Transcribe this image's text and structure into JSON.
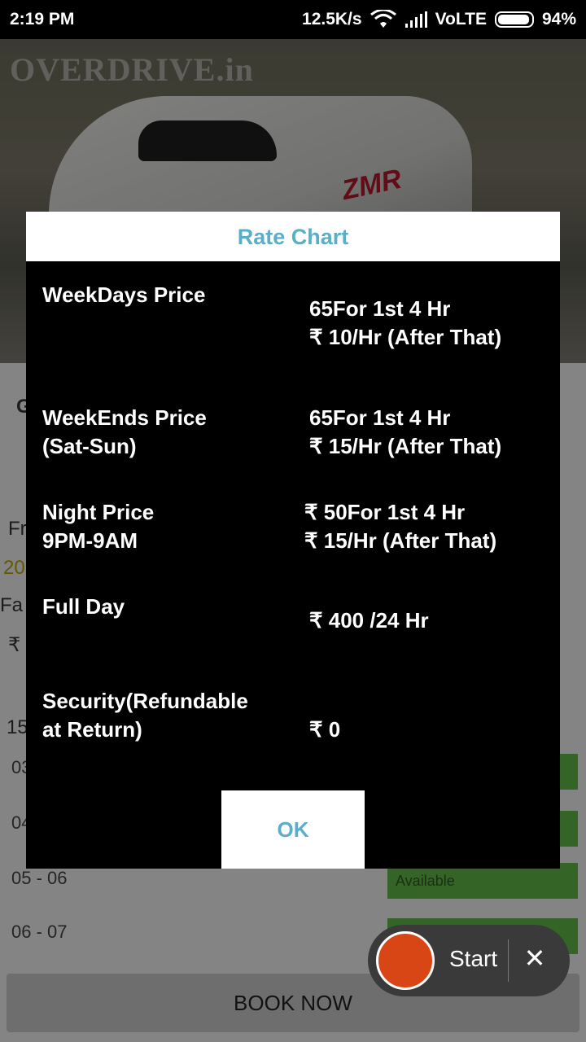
{
  "status_bar": {
    "time": "2:19 PM",
    "net_speed": "12.5K/s",
    "network": "VoLTE",
    "battery": "94%"
  },
  "hero": {
    "watermark": "OVERDRIVE.in",
    "bike_text": "ZMR"
  },
  "background": {
    "fragments": [
      "G",
      "Fr",
      "20",
      "Fa",
      "₹",
      "15"
    ],
    "slots": [
      {
        "time": "03",
        "status": ""
      },
      {
        "time": "04",
        "status": ""
      },
      {
        "time": "05 - 06",
        "status": "Available"
      },
      {
        "time": "06 - 07",
        "status": ""
      }
    ],
    "book_now": "BOOK NOW"
  },
  "dialog": {
    "title": "Rate Chart",
    "rows": [
      {
        "label": "WeekDays Price",
        "value_line1": "65For 1st 4 Hr",
        "value_line2": "₹ 10/Hr (After That)"
      },
      {
        "label_line1": "WeekEnds Price",
        "label_line2": "(Sat-Sun)",
        "value_line1": "65For 1st 4 Hr",
        "value_line2": "₹ 15/Hr (After That)"
      },
      {
        "label_line1": "Night Price",
        "label_line2": "9PM-9AM",
        "value_line1": "₹ 50For 1st 4 Hr",
        "value_line2": "₹ 15/Hr (After That)"
      },
      {
        "label": "Full Day",
        "value": "₹ 400 /24 Hr"
      },
      {
        "label_line1": "Security(Refundable",
        "label_line2": "at Return)",
        "value": "₹ 0"
      }
    ],
    "ok_label": "OK"
  },
  "recorder": {
    "start_label": "Start",
    "close_glyph": "✕"
  }
}
